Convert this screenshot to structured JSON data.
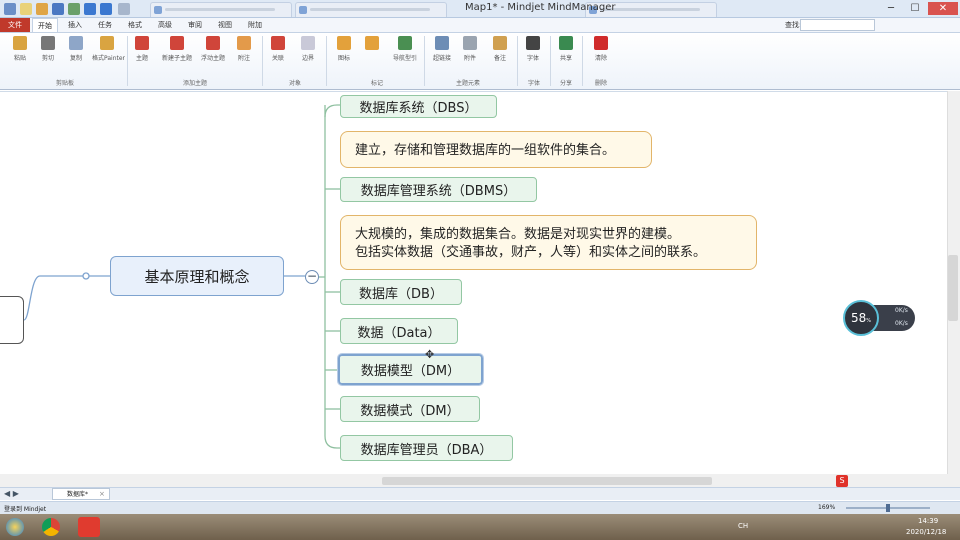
{
  "window": {
    "title": "Map1* - Mindjet MindManager",
    "controls": [
      "─",
      "☐",
      "✕"
    ]
  },
  "menu": {
    "file": "文件",
    "tabs": [
      "开始",
      "插入",
      "任务",
      "格式",
      "高级",
      "审阅",
      "视图",
      "附加"
    ],
    "active": "开始",
    "search_label": "查找:"
  },
  "ribbon": {
    "buttons": [
      {
        "label": "粘贴",
        "icon": "paste-icon",
        "color": "#d9a441"
      },
      {
        "label": "剪切",
        "icon": "cut-icon",
        "color": "#555555"
      },
      {
        "label": "复制",
        "icon": "copy-icon",
        "color": "#8ea6c8"
      },
      {
        "label": "格式Painter",
        "icon": "format-painter-icon",
        "color": "#d9a441"
      },
      {
        "label": "主题",
        "icon": "topic-icon",
        "color": "#d0453a"
      },
      {
        "label": "新建子主题",
        "icon": "subtopic-icon",
        "color": "#d0453a"
      },
      {
        "label": "浮动主题",
        "icon": "floating-topic-icon",
        "color": "#d0453a"
      },
      {
        "label": "附注",
        "icon": "callout-icon",
        "color": "#e39a4a"
      },
      {
        "label": "关联",
        "icon": "relationship-icon",
        "color": "#d0453a"
      },
      {
        "label": "边界",
        "icon": "boundary-icon",
        "color": "#c9c9d8"
      },
      {
        "label": "图标",
        "icon": "icons-icon",
        "color": "#e3a13b"
      },
      {
        "label": "",
        "icon": "pin-icon",
        "color": "#e3a13b"
      },
      {
        "label": "导航型引",
        "icon": "navigator-icon",
        "color": "#4a8f52"
      },
      {
        "label": "超链接",
        "icon": "hyperlink-icon",
        "color": "#6d8db5"
      },
      {
        "label": "附件",
        "icon": "attachment-icon",
        "color": "#9aa4b0"
      },
      {
        "label": "备注",
        "icon": "notes-icon",
        "color": "#d0a050"
      },
      {
        "label": "字体",
        "icon": "font-icon",
        "color": "#444444"
      },
      {
        "label": "共享",
        "icon": "share-icon",
        "color": "#3a8a50"
      },
      {
        "label": "清除",
        "icon": "delete-icon",
        "color": "#d02b2b"
      }
    ],
    "groups": [
      "剪贴板",
      "添加主题",
      "对象",
      "标记",
      "主题元素",
      "字体",
      "分享",
      "删除"
    ]
  },
  "map": {
    "main_topic": "基本原理和概念",
    "topics": [
      "数据库系统（DBS）",
      "数据库管理系统（DBMS）",
      "数据库（DB）",
      "数据（Data）",
      "数据模型（DM）",
      "数据模式（DM）",
      "数据库管理员（DBA）"
    ],
    "callouts": [
      [
        "建立，存储和管理数据库的一组软件的集合。"
      ],
      [
        "大规模的，集成的数据集合。数据是对现实世界的建模。",
        "包括实体数据（交通事故，财产，人等）和实体之间的联系。"
      ]
    ],
    "selected_topic": "数据模型（DM）"
  },
  "zoom_widget": {
    "percent": "58",
    "unit": "%",
    "up": "0K/s",
    "down": "0K/s"
  },
  "doc_tab": "数据库*",
  "status": {
    "left": "登录到 Mindjet",
    "zoom": "169%"
  },
  "taskbar": {
    "time": "14:39",
    "date": "2020/12/18",
    "lang": "CH"
  },
  "colors": {
    "accent": "#c0392b",
    "topic_fill": "#e9f5ec",
    "callout_fill": "#fff9e8",
    "main_fill": "#e8f0fb"
  }
}
